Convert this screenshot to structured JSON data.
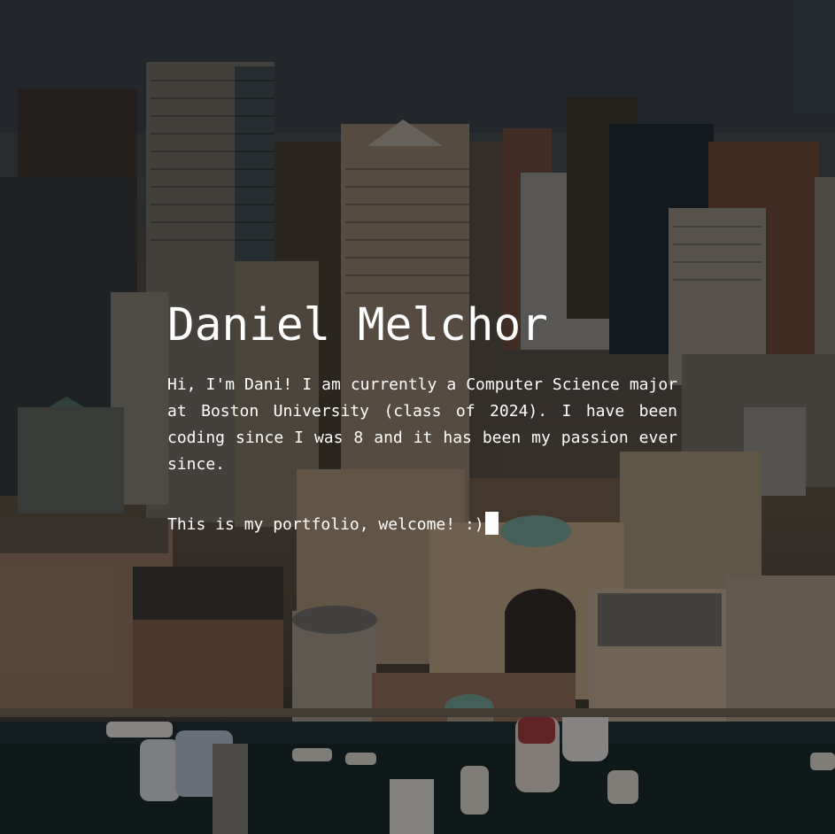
{
  "hero": {
    "background": "aerial photo of a city skyline and harbor",
    "name": "Daniel Melchor",
    "bio": "Hi, I'm Dani! I am currently a Computer Science major at Boston University (class of 2024). I have been coding since I was 8 and it has been my passion ever since.",
    "welcome": "This is my portfolio, welcome! :)",
    "text_color": "#ffffff"
  }
}
